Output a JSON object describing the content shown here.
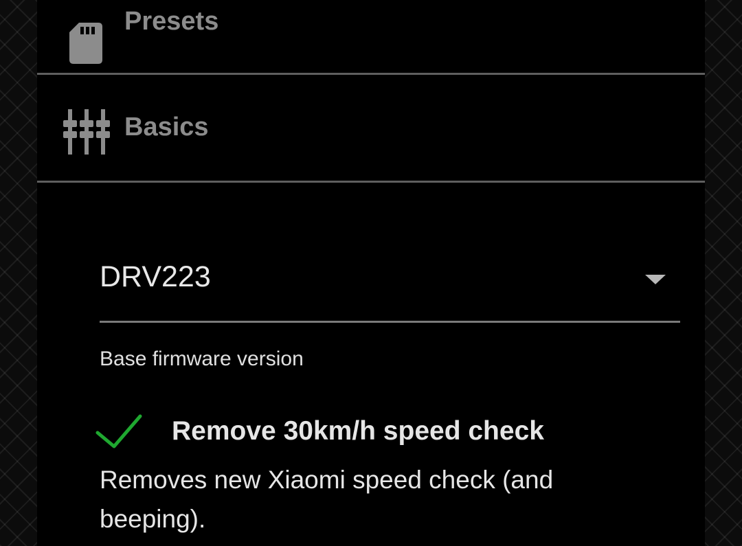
{
  "sections": {
    "presets": {
      "label": "Presets",
      "icon": "sd-card-icon"
    },
    "basics": {
      "label": "Basics",
      "icon": "sliders-icon"
    }
  },
  "firmware_select": {
    "value": "DRV223",
    "helper": "Base firmware version"
  },
  "speed_check": {
    "checked": true,
    "title": "Remove 30km/h speed check",
    "description": "Removes new Xiaomi speed check (and beeping).",
    "check_color": "#1fa830"
  },
  "colors": {
    "header_text": "#8c8c8c",
    "divider": "#5f5f5f",
    "body_text": "#e6e6e6"
  }
}
